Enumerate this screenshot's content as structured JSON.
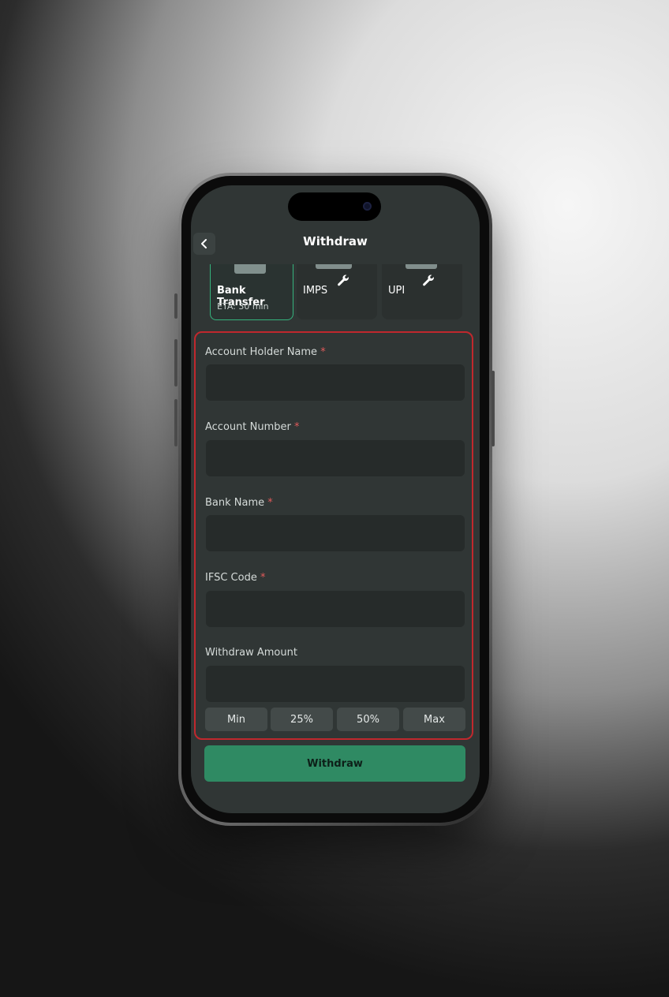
{
  "header": {
    "title": "Withdraw"
  },
  "methods": [
    {
      "name": "Bank Transfer",
      "eta": "ETA: 30 min",
      "selected": true
    },
    {
      "name": "IMPS",
      "status_icon": "wrench-icon"
    },
    {
      "name": "UPI",
      "status_icon": "wrench-icon"
    }
  ],
  "form": {
    "fields": [
      {
        "label": "Account Holder Name",
        "required_mark": "*",
        "value": ""
      },
      {
        "label": "Account Number",
        "required_mark": "*",
        "value": ""
      },
      {
        "label": "Bank Name",
        "required_mark": "*",
        "value": ""
      },
      {
        "label": "IFSC Code",
        "required_mark": "*",
        "value": ""
      },
      {
        "label": "Withdraw Amount",
        "value": ""
      }
    ],
    "amount_presets": [
      "Min",
      "25%",
      "50%",
      "Max"
    ]
  },
  "actions": {
    "submit_label": "Withdraw"
  },
  "colors": {
    "accent": "#2f8a63",
    "selected_border": "#35b37d",
    "highlight_border": "#c0282d",
    "screen_bg": "#303635",
    "input_bg": "#262b2a"
  }
}
